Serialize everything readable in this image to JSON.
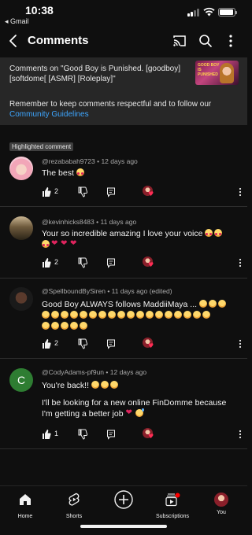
{
  "status_bar": {
    "time": "10:38",
    "back_app": "◂ Gmail"
  },
  "header": {
    "title": "Comments"
  },
  "video": {
    "caption": "Comments on \"Good Boy is Punished. [goodboy] [softdome[ [ASMR] [Roleplay]\"",
    "thumb_text": "GOOD BOY IS PUNISHED"
  },
  "rules": {
    "text": "Remember to keep comments respectful and to follow our ",
    "link": "Community Guidelines"
  },
  "highlighted_label": "Highlighted comment",
  "comments": [
    {
      "handle": "@rezababah9723",
      "time": "12 days ago",
      "text": "The best",
      "likes": "2"
    },
    {
      "handle": "@kevinhicks8483",
      "time": "11 days ago",
      "text": "Your so incredible amazing  I love your voice",
      "likes": "2"
    },
    {
      "handle": "@SpellboundBySiren",
      "time": "11 days ago (edited)",
      "text": "Good Boy ALWAYS follows MaddiiMaya ...",
      "likes": "2"
    },
    {
      "handle": "@CodyAdams-pf9un",
      "time": "12 days ago",
      "text_line1": "You're back!!",
      "text_line2": "I'll be looking for a new online FinDomme because I'm getting a better job",
      "likes": "1",
      "avatar_letter": "C"
    }
  ],
  "separator": "•",
  "nav": {
    "home": "Home",
    "shorts": "Shorts",
    "subscriptions": "Subscriptions",
    "you": "You"
  },
  "colors": {
    "background": "#0f0f0f",
    "card": "#272727",
    "link": "#3ea6ff",
    "avatar_green": "#2e7d32"
  }
}
